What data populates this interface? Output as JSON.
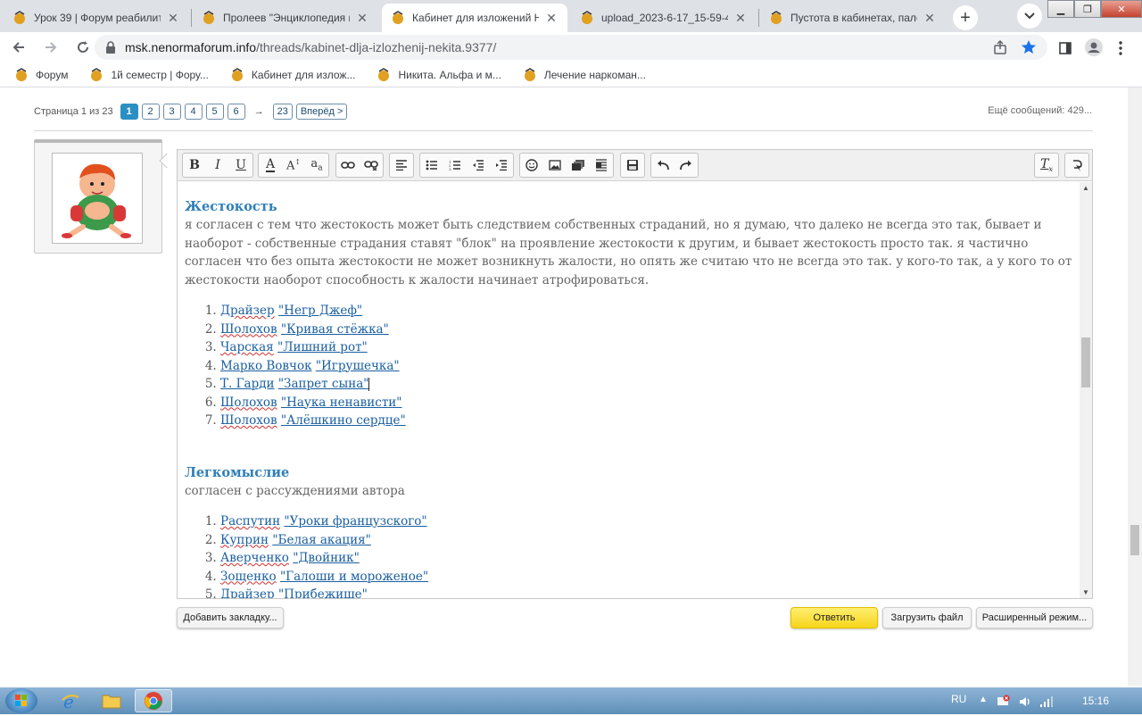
{
  "browser": {
    "tabs": [
      {
        "title": "Урок 39 | Форум реабилит",
        "active": false
      },
      {
        "title": "Пролеев \"Энциклопедия п",
        "active": false
      },
      {
        "title": "Кабинет для изложений Н",
        "active": true
      },
      {
        "title": "upload_2023-6-17_15-59-4",
        "active": false
      },
      {
        "title": "Пустота в кабинетах, пало",
        "active": false
      }
    ],
    "url_host": "msk.nenormaforum.info",
    "url_path": "/threads/kabinet-dlja-izlozhenij-nekita.9377/",
    "bookmarks": [
      "Форум",
      "1й семестр | Фору...",
      "Кабинет для излож...",
      "Никита. Альфа и м...",
      "Лечение наркоман..."
    ]
  },
  "pagination": {
    "label": "Страница 1 из 23",
    "pages": [
      "1",
      "2",
      "3",
      "4",
      "5",
      "6"
    ],
    "arrow": "→",
    "last": "23",
    "next": "Вперёд >",
    "more_messages": "Ещё сообщений: 429..."
  },
  "editor": {
    "section1": {
      "heading": "Жестокость",
      "text": "я согласен с тем что жестокость может быть следствием собственных страданий, но я думаю, что далеко не всегда это так, бывает и наоборот - собственные страдания ставят \"блок\" на проявление жестокости к другим, и бывает жестокость просто так. я частично согласен что без опыта жестокости не может возникнуть жалости, но опять же считаю что не всегда это так.  у кого-то так, а у кого то от жестокости наоборот способность к жалости начинает атрофироваться."
    },
    "list1": [
      {
        "author": "Драйзер",
        "work": "\"Негр Джеф\""
      },
      {
        "author": "Шолохов",
        "work": "\"Кривая стёжка\""
      },
      {
        "author": "Чарская",
        "work": "\"Лишний рот\""
      },
      {
        "author": "Марко Вовчок",
        "work": "\"Игрушечка\""
      },
      {
        "author": "Т. Гарди",
        "work": "\"Запрет сына\""
      },
      {
        "author": "Шолохов",
        "work": "\"Наука ненависти\""
      },
      {
        "author": "Шолохов",
        "work": "\"Алёшкино сердце\""
      }
    ],
    "section2": {
      "heading": "Легкомыслие",
      "text": "согласен с рассуждениями автора"
    },
    "list2": [
      {
        "author": "Распутин",
        "work": "\"Уроки французского\""
      },
      {
        "author": "Куприн",
        "work": "\"Белая акация\""
      },
      {
        "author": "Аверченко",
        "work": "\"Двойник\""
      },
      {
        "author": "Зощенко",
        "work": "\"Галоши и мороженое\""
      },
      {
        "author": "Драйзер",
        "work": "\"Прибежище\""
      }
    ]
  },
  "buttons": {
    "bookmark": "Добавить закладку...",
    "reply": "Ответить",
    "upload": "Загрузить файл",
    "advanced": "Расширенный режим..."
  },
  "taskbar": {
    "lang": "RU",
    "time": "15:16"
  },
  "colors": {
    "accent": "#2a8fc3",
    "heading": "#2f7fb8",
    "reply_button": "#f7d51b"
  }
}
